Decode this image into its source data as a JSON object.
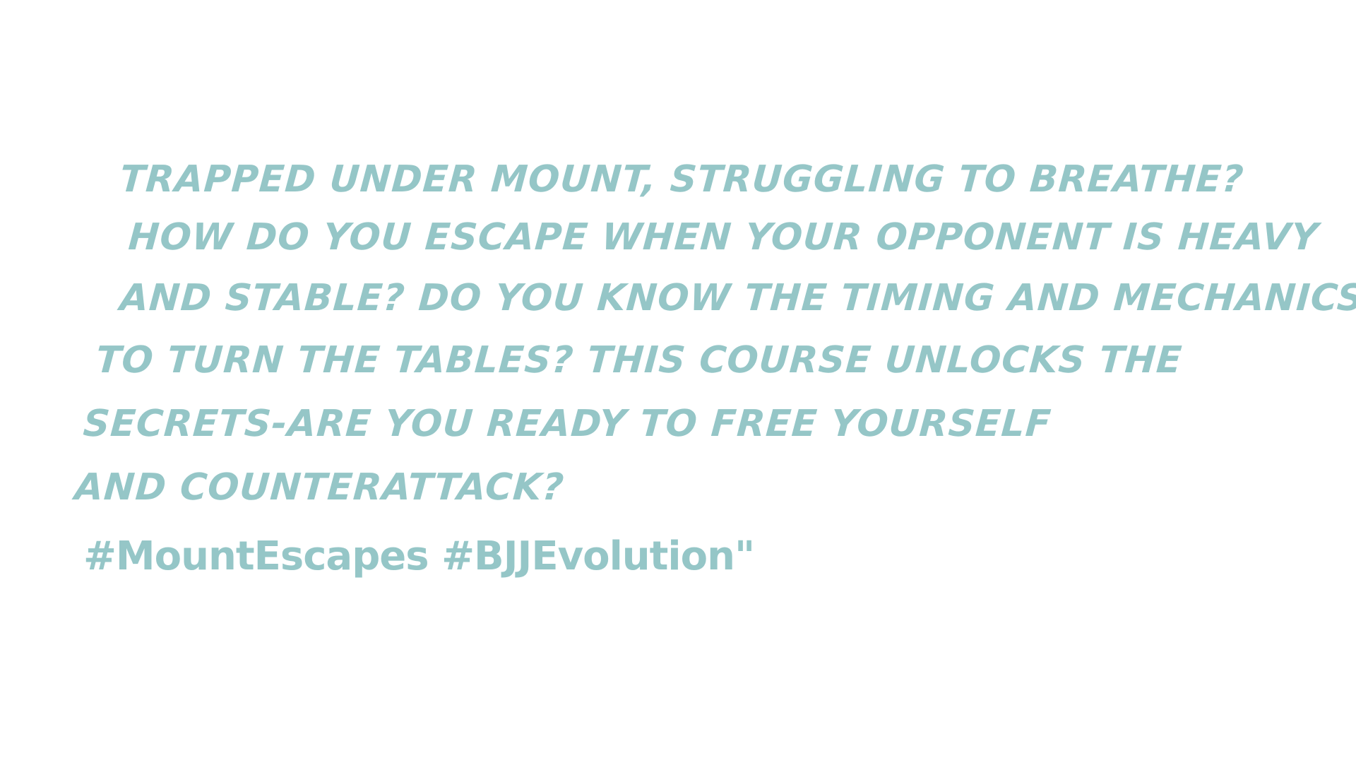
{
  "text": {
    "lines": [
      "TRAPPED UNDER MOUNT, STRUGGLING TO BREATHE?",
      "HOW DO YOU ESCAPE WHEN YOUR OPPONENT IS HEAVY",
      "AND STABLE? DO YOU KNOW THE TIMING AND MECHANICS",
      "TO TURN THE TABLES? THIS COURSE UNLOCKS THE",
      "SECRETS-ARE YOU READY TO FREE YOURSELF",
      "AND COUNTERATTACK?"
    ],
    "hashtags": "#MountEscapes #BJJEvolution\""
  },
  "colors": {
    "background": "#ffffff",
    "text": "#95c6c7"
  }
}
